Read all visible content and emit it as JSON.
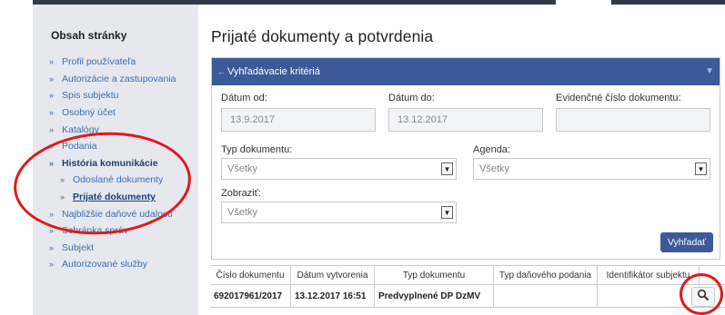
{
  "sidebar": {
    "title": "Obsah stránky",
    "items": [
      {
        "label": "Profil používateľa"
      },
      {
        "label": "Autorizácie a zastupovania"
      },
      {
        "label": "Spis subjektu"
      },
      {
        "label": "Osobný účet"
      },
      {
        "label": "Katalógy"
      },
      {
        "label": "Podania"
      },
      {
        "label": "História komunikácie"
      },
      {
        "label": "Odoslané dokumenty"
      },
      {
        "label": "Prijaté dokumenty"
      },
      {
        "label": "Najbližšie daňové udalosti"
      },
      {
        "label": "Schránka správ"
      },
      {
        "label": "Subjekt"
      },
      {
        "label": "Autorizované služby"
      }
    ]
  },
  "main": {
    "title": "Prijaté dokumenty a potvrdenia"
  },
  "search_panel": {
    "title": "Vyhľadávacie kritériá",
    "date_from_label": "Dátum od:",
    "date_from_value": "13.9.2017",
    "date_to_label": "Dátum do:",
    "date_to_value": "13.12.2017",
    "doc_number_label": "Evidenčné číslo dokumentu:",
    "doc_number_value": "",
    "doc_type_label": "Typ dokumentu:",
    "doc_type_value": "Všetky",
    "agenda_label": "Agenda:",
    "agenda_value": "Všetky",
    "display_label": "Zobraziť:",
    "display_value": "Všetky",
    "search_button": "Vyhľadať"
  },
  "table": {
    "headers": [
      "Číslo dokumentu",
      "Dátum vytvorenia",
      "Typ dokumentu",
      "Typ daňového podania",
      "Identifikátor subjektu"
    ],
    "rows": [
      [
        "692017961/2017",
        "13.12.2017 16:51",
        "Predvyplnené DP DzMV",
        "",
        ""
      ]
    ]
  },
  "colors": {
    "accent": "#3c5a99",
    "annotation": "#e11a1a",
    "link": "#3a6db0"
  }
}
